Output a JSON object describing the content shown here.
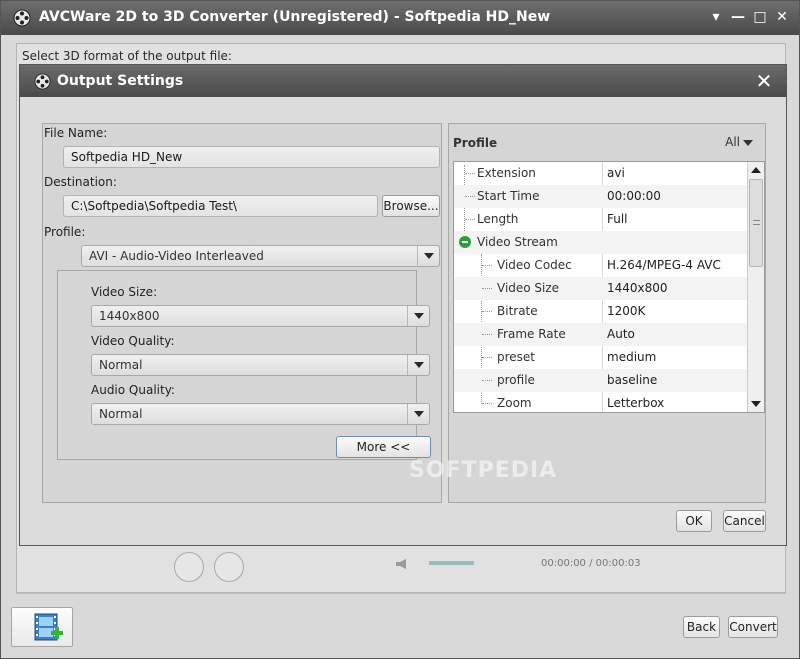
{
  "window": {
    "title": "AVCWare 2D to 3D Converter (Unregistered) - Softpedia HD_New",
    "controls": {
      "dropdown": "▾",
      "minimize": "—",
      "maximize": "□",
      "close": "✕"
    }
  },
  "main": {
    "prompt": "Select 3D format of the output file:",
    "player_time": "00:00:00 / 00:00:03"
  },
  "dialog": {
    "title": "Output Settings",
    "close_icon": "✕",
    "file_name_label": "File Name:",
    "file_name_value": "Softpedia HD_New",
    "destination_label": "Destination:",
    "destination_value": "C:\\Softpedia\\Softpedia Test\\",
    "browse_label": "Browse...",
    "profile_label": "Profile:",
    "profile_value": "AVI - Audio-Video Interleaved",
    "video_size_label": "Video Size:",
    "video_size_value": "1440x800",
    "video_quality_label": "Video Quality:",
    "video_quality_value": "Normal",
    "audio_quality_label": "Audio Quality:",
    "audio_quality_value": "Normal",
    "more_label": "More <<",
    "ok_label": "OK",
    "cancel_label": "Cancel",
    "watermark": "SOFTPEDIA"
  },
  "profile_panel": {
    "header": "Profile",
    "filter": "All",
    "rows": [
      {
        "key": "Extension",
        "value": "avi"
      },
      {
        "key": "Start Time",
        "value": "00:00:00"
      },
      {
        "key": "Length",
        "value": "Full"
      },
      {
        "key": "Video Stream",
        "value": ""
      },
      {
        "key": "Video Codec",
        "value": "H.264/MPEG-4 AVC"
      },
      {
        "key": "Video Size",
        "value": "1440x800"
      },
      {
        "key": "Bitrate",
        "value": "1200K"
      },
      {
        "key": "Frame Rate",
        "value": "Auto"
      },
      {
        "key": "preset",
        "value": "medium"
      },
      {
        "key": "profile",
        "value": "baseline"
      },
      {
        "key": "Zoom",
        "value": "Letterbox"
      }
    ]
  },
  "bottom": {
    "back_label": "Back",
    "convert_label": "Convert"
  },
  "colors": {
    "titlebar": "#555555",
    "accent_green": "#2f9e3a",
    "panel": "#d5d5d5"
  }
}
